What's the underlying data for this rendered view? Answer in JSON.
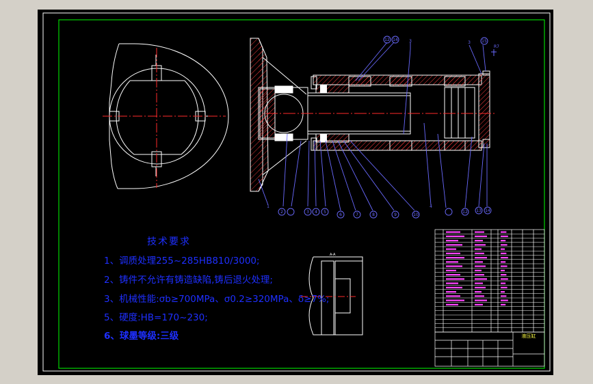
{
  "technical_requirements": {
    "title": "技术要求",
    "items": [
      "1、调质处理255~285HB810/3000;",
      "2、铸件不允许有铸造缺陷,铸后退火处理;",
      "3、机械性能:σb≥700MPa、σ0.2≥320MPa、δ≥7%;",
      "5、硬度:HB=170~230;",
      "6、球墨等级:三级"
    ]
  },
  "balloons_bottom": [
    "1",
    "2",
    "3",
    "4",
    "5",
    "6",
    "7",
    "8",
    "9",
    "10",
    "4",
    "12",
    "13",
    "14"
  ],
  "balloons_top": [
    "12",
    "14",
    "3",
    "3",
    "15"
  ],
  "title_block": {
    "name": "液压缸"
  },
  "colors": {
    "background": "#000000",
    "frame_outer": "#ffffff",
    "frame_inner": "#00ff00",
    "part_lines": "#ffffff",
    "center_lines": "#ff2a2a",
    "leaders": "#6a6aff",
    "hatch": "#ff3c3c",
    "table_text": "#ff44ff",
    "tech_text": "#1e2fff",
    "app_chrome": "#d4d0c8"
  }
}
